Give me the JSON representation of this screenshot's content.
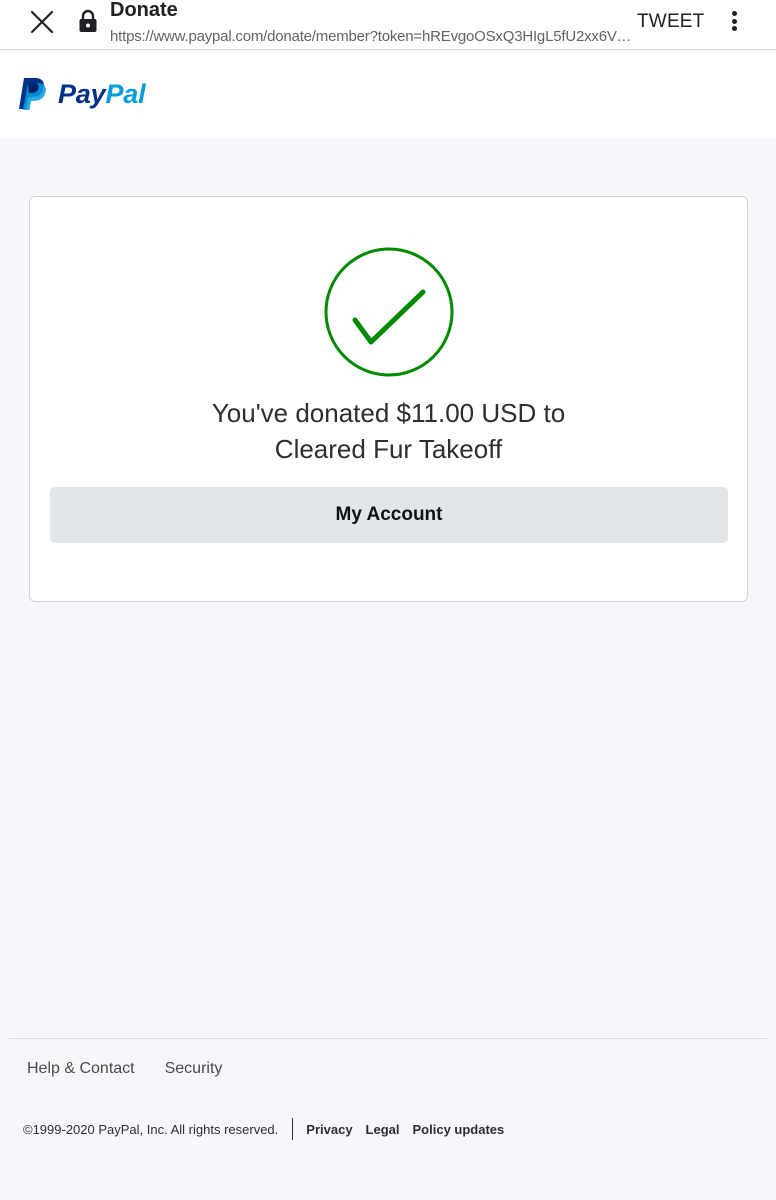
{
  "browser": {
    "tab_title": "Donate",
    "url": "https://www.paypal.com/donate/member?token=hREvgoOSxQ3HIgL5fU2xx6Vih…",
    "tweet_label": "TWEET",
    "close_icon": "close-icon",
    "lock_icon": "lock-icon",
    "menu_icon": "more-vert-icon"
  },
  "header": {
    "logo_pay": "Pay",
    "logo_pal": "Pal",
    "colors": {
      "pay": "#003087",
      "pal": "#009cde"
    }
  },
  "confirmation": {
    "icon": "checkmark-circle-icon",
    "icon_color": "#008a00",
    "line1": "You've donated $11.00 USD to",
    "line2": "Cleared Fur Takeoff",
    "button_label": "My Account"
  },
  "footer": {
    "links": [
      "Help & Contact",
      "Security"
    ],
    "copyright": "©1999-2020  PayPal, Inc. All rights reserved.",
    "legal_links": [
      "Privacy",
      "Legal",
      "Policy updates"
    ]
  }
}
